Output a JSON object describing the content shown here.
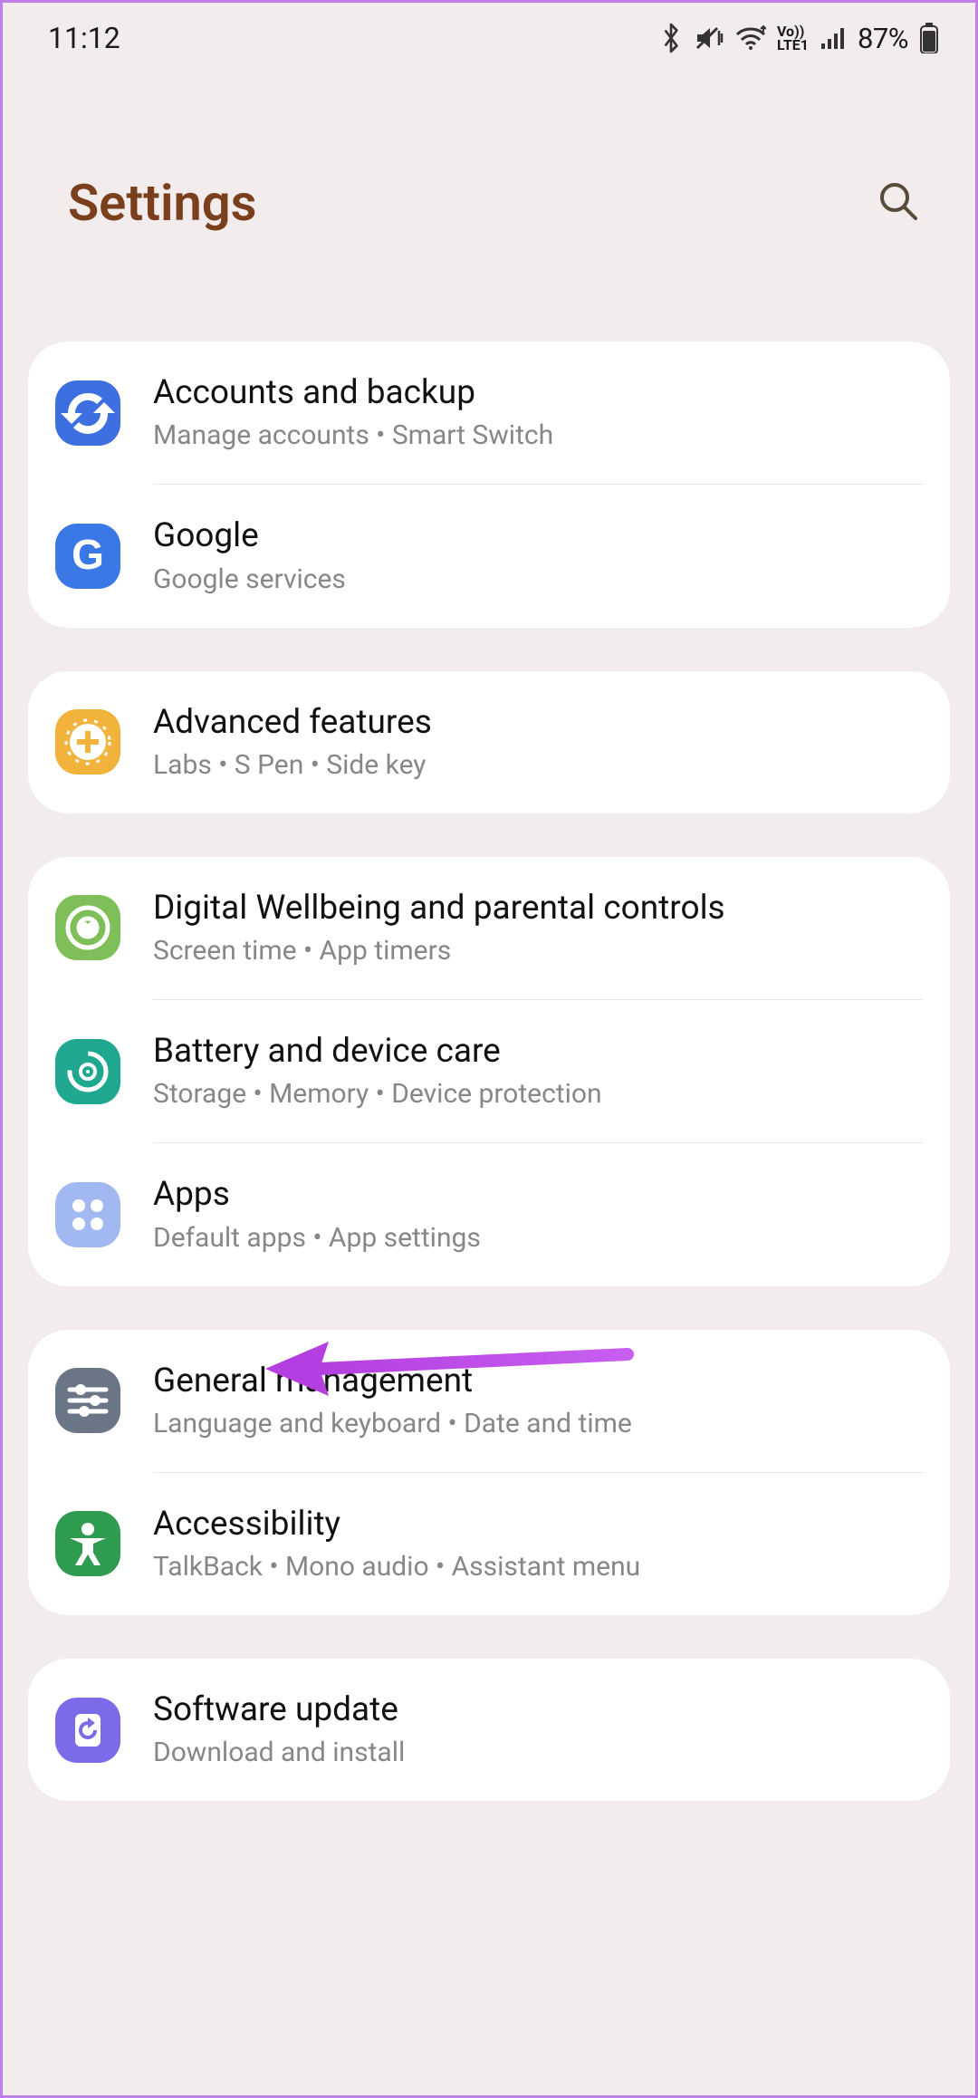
{
  "status": {
    "time": "11:12",
    "battery": "87%"
  },
  "header": {
    "title": "Settings"
  },
  "groups": [
    {
      "items": [
        {
          "key": "accounts",
          "title": "Accounts and backup",
          "sub": "Manage accounts  •  Smart Switch",
          "icon": "sync-icon",
          "color": "c-blue"
        },
        {
          "key": "google",
          "title": "Google",
          "sub": "Google services",
          "icon": "google-icon",
          "color": "c-blue2"
        }
      ]
    },
    {
      "items": [
        {
          "key": "advanced",
          "title": "Advanced features",
          "sub": "Labs  •  S Pen  •  Side key",
          "icon": "plus-gear-icon",
          "color": "c-orange"
        }
      ]
    },
    {
      "items": [
        {
          "key": "wellbeing",
          "title": "Digital Wellbeing and parental controls",
          "sub": "Screen time  •  App timers",
          "icon": "wellbeing-icon",
          "color": "c-green"
        },
        {
          "key": "battery",
          "title": "Battery and device care",
          "sub": "Storage  •  Memory  •  Device protection",
          "icon": "care-icon",
          "color": "c-teal"
        },
        {
          "key": "apps",
          "title": "Apps",
          "sub": "Default apps  •  App settings",
          "icon": "apps-icon",
          "color": "c-lblue"
        }
      ]
    },
    {
      "items": [
        {
          "key": "general",
          "title": "General management",
          "sub": "Language and keyboard  •  Date and time",
          "icon": "sliders-icon",
          "color": "c-slate"
        },
        {
          "key": "accessibility",
          "title": "Accessibility",
          "sub": "TalkBack  •  Mono audio  •  Assistant menu",
          "icon": "accessibility-icon",
          "color": "c-dgreen"
        }
      ]
    },
    {
      "items": [
        {
          "key": "update",
          "title": "Software update",
          "sub": "Download and install",
          "icon": "update-icon",
          "color": "c-purple"
        }
      ]
    }
  ],
  "annotation": {
    "target": "apps",
    "color": "#b43fe0"
  }
}
